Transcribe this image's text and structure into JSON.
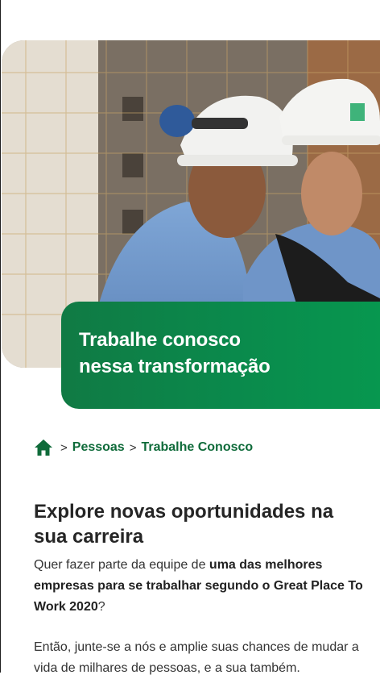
{
  "hero": {
    "image_alt": "Dois trabalhadores com capacetes brancos em obra",
    "title_line1": "Trabalhe conosco",
    "title_line2": "nessa transformação"
  },
  "breadcrumb": {
    "home_icon": "home-icon",
    "separator": ">",
    "items": [
      "Pessoas",
      "Trabalhe Conosco"
    ]
  },
  "content": {
    "heading": "Explore novas oportunidades na sua carreira",
    "intro_prefix": "Quer fazer parte da equipe de ",
    "intro_bold": "uma das melhores empresas para se trabalhar segundo o Great Place To Work 2020",
    "intro_suffix": "?",
    "paragraph2": "Então, junte-se a nós e amplie suas chances de mudar a vida de milhares de pessoas, e a sua também."
  },
  "colors": {
    "brand_green": "#0a8a4c",
    "link_green": "#0f6b3a",
    "text": "#333333"
  }
}
